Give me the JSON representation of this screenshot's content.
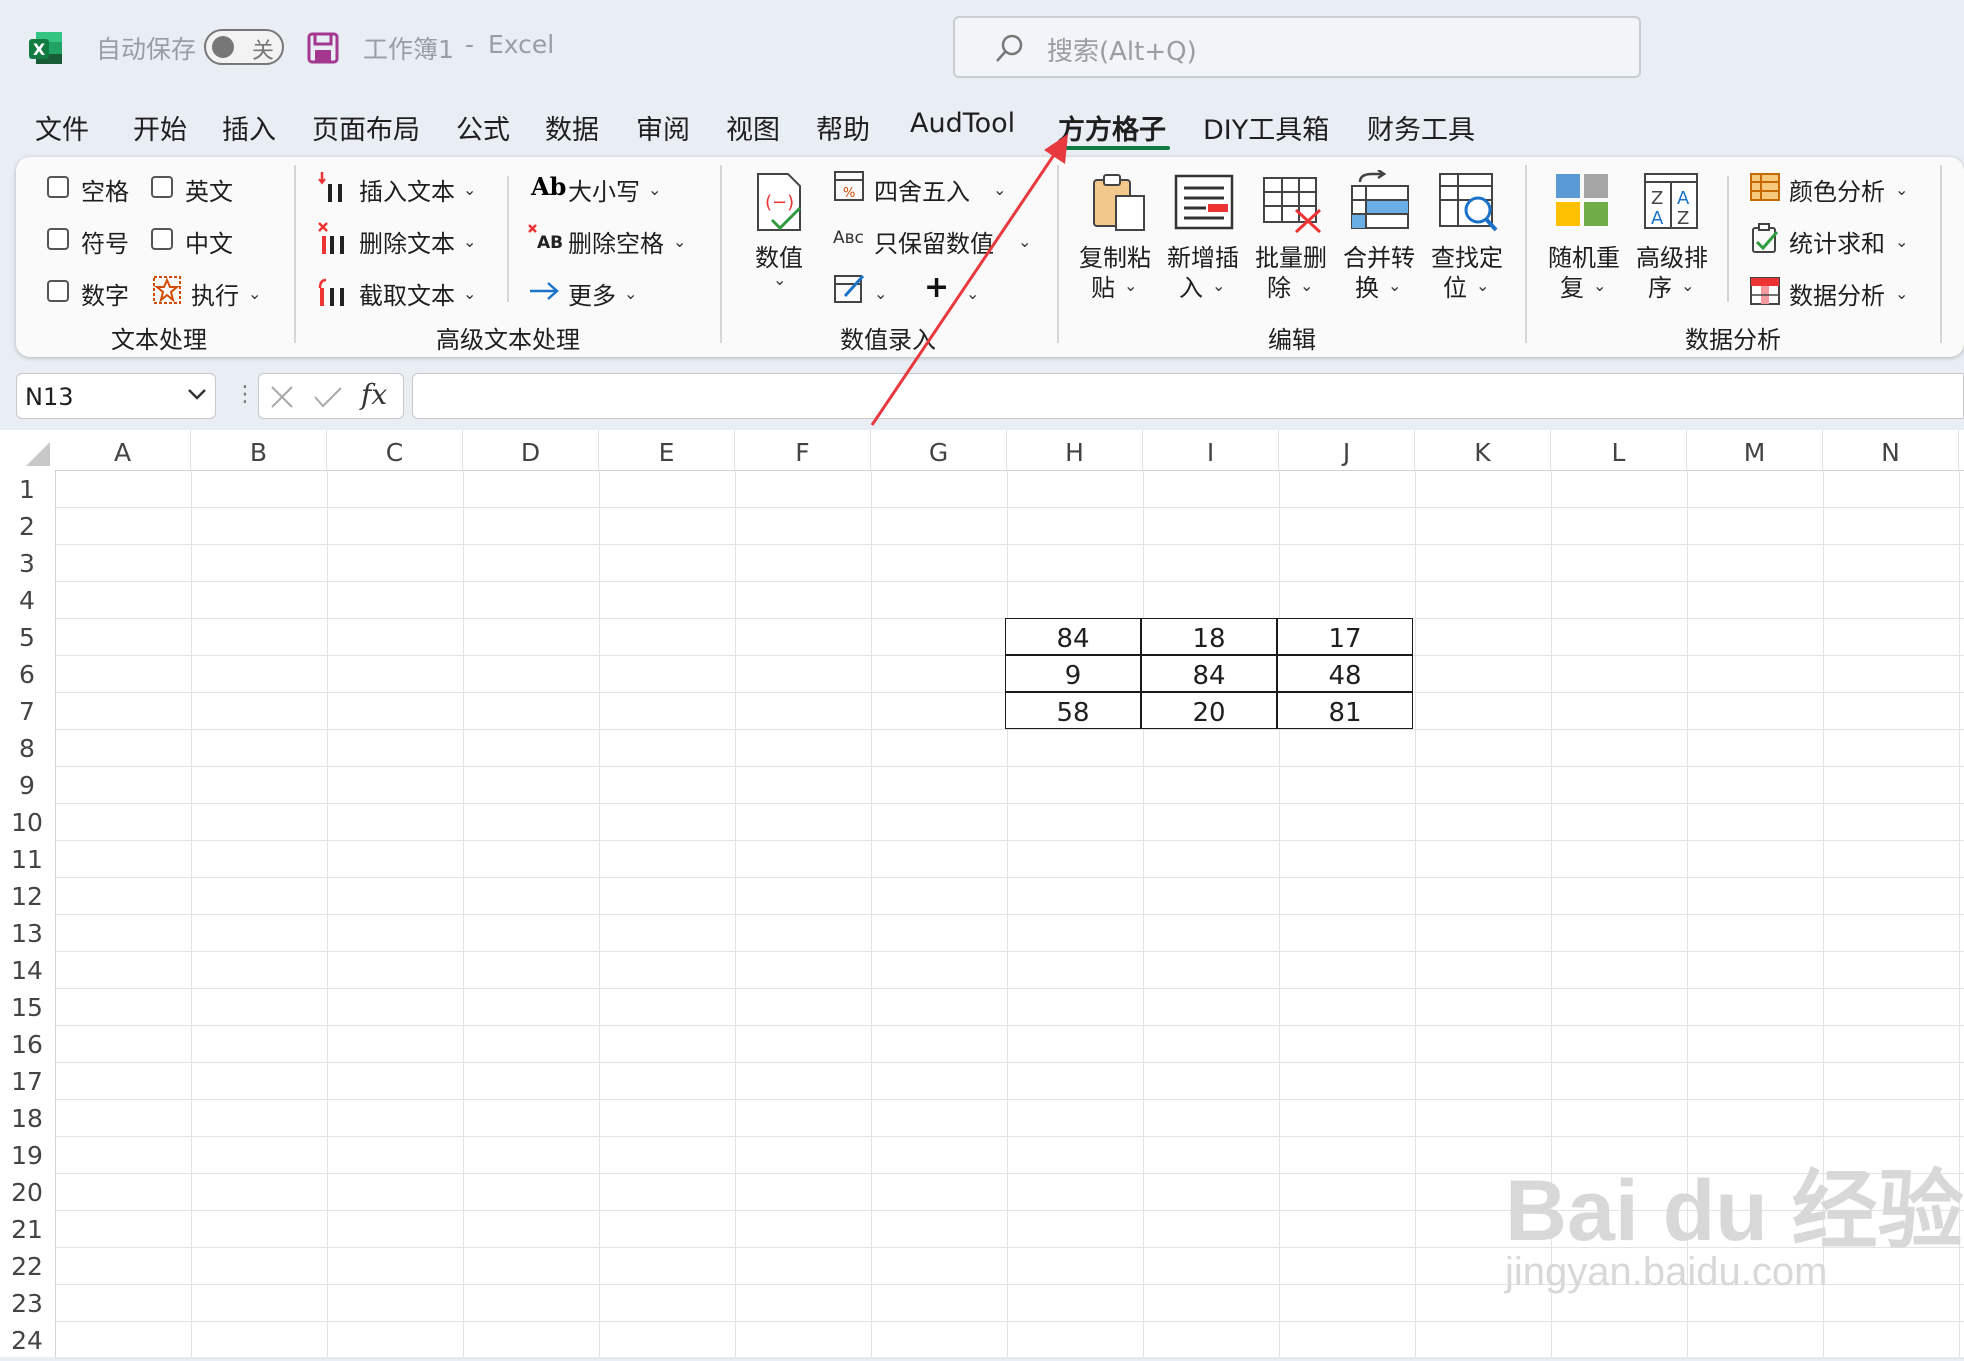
{
  "titlebar": {
    "autosave_label": "自动保存",
    "autosave_state": "关",
    "workbook": "工作簿1",
    "dash": "-",
    "app": "Excel"
  },
  "search": {
    "placeholder": "搜索(Alt+Q)"
  },
  "menu": [
    "文件",
    "开始",
    "插入",
    "页面布局",
    "公式",
    "数据",
    "审阅",
    "视图",
    "帮助",
    "AudTool",
    "方方格子",
    "DIY工具箱",
    "财务工具"
  ],
  "ribbon": {
    "text_group": {
      "checkboxes": [
        "空格",
        "英文",
        "符号",
        "中文",
        "数字"
      ],
      "execute": "执行",
      "label": "文本处理"
    },
    "adv_text_group": {
      "insert_text": "插入文本",
      "delete_text": "删除文本",
      "cut_text": "截取文本",
      "case": "大小写",
      "delete_space": "删除空格",
      "more": "更多",
      "label": "高级文本处理"
    },
    "value_group": {
      "value": "数值",
      "round": "四舍五入",
      "keep_value": "只保留数值",
      "label": "数值录入"
    },
    "edit_group": {
      "copy_paste": [
        "复制粘",
        "贴"
      ],
      "new_insert": [
        "新增插",
        "入"
      ],
      "batch_delete": [
        "批量删",
        "除"
      ],
      "merge_convert": [
        "合并转",
        "换"
      ],
      "find_locate": [
        "查找定",
        "位"
      ],
      "label": "编辑"
    },
    "analysis_group": {
      "random_repeat": [
        "随机重",
        "复"
      ],
      "adv_sort": [
        "高级排",
        "序"
      ],
      "color_analysis": "颜色分析",
      "stat_sum": "统计求和",
      "data_analysis": "数据分析",
      "label": "数据分析"
    }
  },
  "formula_bar": {
    "name_box": "N13",
    "fx": "fx"
  },
  "columns": [
    "A",
    "B",
    "C",
    "D",
    "E",
    "F",
    "G",
    "H",
    "I",
    "J",
    "K",
    "L",
    "M",
    "N"
  ],
  "rows": [
    "1",
    "2",
    "3",
    "4",
    "5",
    "6",
    "7",
    "8",
    "9",
    "10",
    "11",
    "12",
    "13",
    "14",
    "15",
    "16",
    "17",
    "18",
    "19",
    "20",
    "21",
    "22",
    "23",
    "24"
  ],
  "table": [
    [
      "84",
      "18",
      "17"
    ],
    [
      "9",
      "84",
      "48"
    ],
    [
      "58",
      "20",
      "81"
    ]
  ],
  "watermark": {
    "main": "Bai du 经验",
    "sub": "jingyan.baidu.com"
  },
  "colors": {
    "excel_green": "#107c41",
    "arrow_red": "#e8393f"
  }
}
